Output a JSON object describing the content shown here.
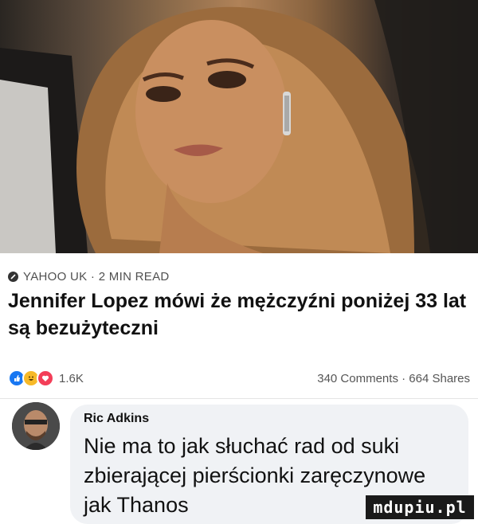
{
  "post": {
    "source": "YAHOO UK · 2 MIN READ",
    "headline": "Jennifer Lopez mówi że mężczyźni poniżej 33 lat są bezużyteczni"
  },
  "stats": {
    "reactions_count": "1.6K",
    "comments_shares": "340 Comments · 664 Shares"
  },
  "comment": {
    "author": "Ric Adkins",
    "text": "Nie ma to jak słuchać rad od suki zbierającej pierścionki zaręczynowe jak Thanos"
  },
  "icons": {
    "source": "globe-icon",
    "reactions": [
      "like-icon",
      "haha-icon",
      "love-icon"
    ]
  },
  "watermark": "mdupiu.pl",
  "colors": {
    "like": "#1877f2",
    "haha": "#f7b928",
    "love": "#f33e58",
    "bubble": "#f0f2f5"
  }
}
